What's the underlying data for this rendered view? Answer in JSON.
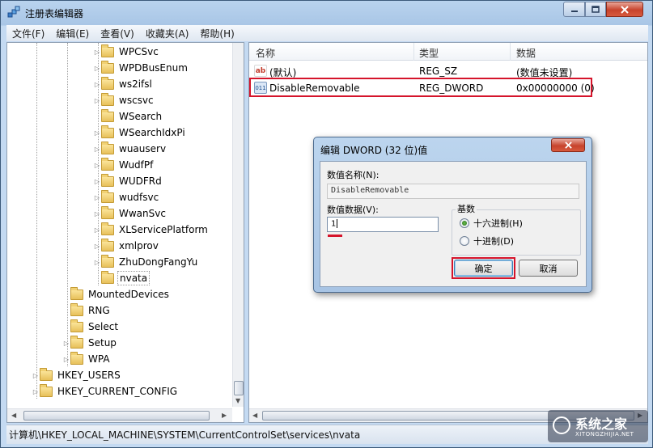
{
  "window": {
    "title": "注册表编辑器"
  },
  "menu": [
    {
      "label": "文件(F)"
    },
    {
      "label": "编辑(E)"
    },
    {
      "label": "查看(V)"
    },
    {
      "label": "收藏夹(A)"
    },
    {
      "label": "帮助(H)"
    }
  ],
  "tree": {
    "items": [
      {
        "label": "WPCSvc",
        "expandable": true
      },
      {
        "label": "WPDBusEnum",
        "expandable": true
      },
      {
        "label": "ws2ifsl",
        "expandable": true
      },
      {
        "label": "wscsvc",
        "expandable": true
      },
      {
        "label": "WSearch",
        "expandable": false
      },
      {
        "label": "WSearchIdxPi",
        "expandable": true
      },
      {
        "label": "wuauserv",
        "expandable": true
      },
      {
        "label": "WudfPf",
        "expandable": true
      },
      {
        "label": "WUDFRd",
        "expandable": true
      },
      {
        "label": "wudfsvc",
        "expandable": true
      },
      {
        "label": "WwanSvc",
        "expandable": true
      },
      {
        "label": "XLServicePlatform",
        "expandable": true
      },
      {
        "label": "xmlprov",
        "expandable": true
      },
      {
        "label": "ZhuDongFangYu",
        "expandable": true
      },
      {
        "label": "nvata",
        "expandable": false,
        "selected": true
      },
      {
        "label": "MountedDevices",
        "expandable": false
      },
      {
        "label": "RNG",
        "expandable": false
      },
      {
        "label": "Select",
        "expandable": false
      },
      {
        "label": "Setup",
        "expandable": true
      },
      {
        "label": "WPA",
        "expandable": true
      },
      {
        "label": "HKEY_USERS",
        "expandable": true
      },
      {
        "label": "HKEY_CURRENT_CONFIG",
        "expandable": true
      }
    ]
  },
  "list": {
    "columns": [
      "名称",
      "类型",
      "数据"
    ],
    "rows": [
      {
        "name": "(默认)",
        "type": "REG_SZ",
        "data": "(数值未设置)",
        "icon": "ab"
      },
      {
        "name": "DisableRemovable",
        "type": "REG_DWORD",
        "data": "0x00000000 (0)",
        "icon": "011"
      }
    ]
  },
  "statusbar": {
    "path": "计算机\\HKEY_LOCAL_MACHINE\\SYSTEM\\CurrentControlSet\\services\\nvata"
  },
  "watermark": {
    "text": "系统之家",
    "url": "XITONGZHIJIA.NET"
  },
  "dialog": {
    "title": "编辑 DWORD (32 位)值",
    "value_name_label": "数值名称(N):",
    "value_name": "DisableRemovable",
    "value_data_label": "数值数据(V):",
    "value_data": "1",
    "base_label": "基数",
    "radio_hex": "十六进制(H)",
    "radio_dec": "十进制(D)",
    "ok_label": "确定",
    "cancel_label": "取消"
  },
  "colors": {
    "highlight": "#d5142b",
    "titlebar": "#b9d3ee",
    "close": "#c7432c"
  }
}
